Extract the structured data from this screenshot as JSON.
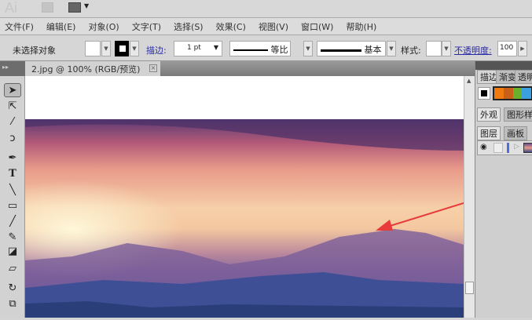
{
  "app": {
    "logo": "Ai"
  },
  "menu": [
    "文件(F)",
    "编辑(E)",
    "对象(O)",
    "文字(T)",
    "选择(S)",
    "效果(C)",
    "视图(V)",
    "窗口(W)",
    "帮助(H)"
  ],
  "control": {
    "selection": "未选择对象",
    "stroke_label": "描边:",
    "stroke_weight": "1 pt",
    "profile": "等比",
    "brush": "基本",
    "style_label": "样式:",
    "opacity_label": "不透明度:",
    "opacity": "100"
  },
  "document": {
    "tab": "2.jpg @ 100% (RGB/预览)"
  },
  "panel": {
    "tabs1": [
      "描边",
      "渐变",
      "透明"
    ],
    "tabs2": [
      "外观",
      "图形样式"
    ],
    "tabs3": [
      "图层",
      "画板"
    ],
    "swatches": [
      "#000000",
      "#f07a10",
      "#c8601a",
      "#6ab02a",
      "#3aa0e0"
    ]
  },
  "annotation": {
    "arrow_color": "#e83a3a"
  }
}
